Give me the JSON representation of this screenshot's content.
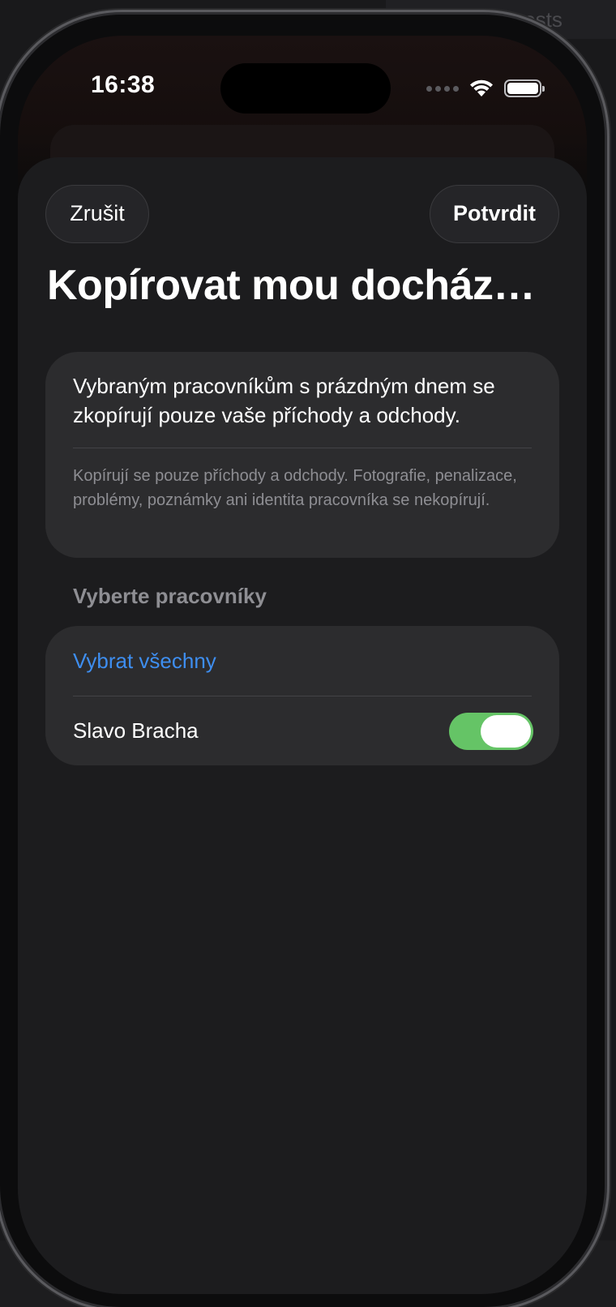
{
  "background": {
    "top_right_text": "Pull requests"
  },
  "status_bar": {
    "time": "16:38"
  },
  "sheet": {
    "cancel_label": "Zrušit",
    "confirm_label": "Potvrdit",
    "title": "Kopírovat mou docház…",
    "info": {
      "main": "Vybraným pracovníkům s prázdným dnem se zkopírují pouze vaše příchody a odchody.",
      "note": "Kopírují se pouze příchody a odchody. Fotografie, penalizace, problémy, poznámky ani identita pracovníka se nekopírují."
    },
    "workers": {
      "section_header": "Vyberte pracovníky",
      "select_all_label": "Vybrat všechny",
      "items": [
        {
          "name": "Slavo Bracha",
          "selected": true
        }
      ]
    }
  },
  "colors": {
    "accent": "#3e8ef0",
    "toggle_on": "#65c466",
    "sheet_background": "#1c1c1e",
    "card_background": "#2c2c2e"
  },
  "icons": [
    "pull-request-icon",
    "cellular-icon",
    "wifi-icon",
    "battery-icon"
  ]
}
